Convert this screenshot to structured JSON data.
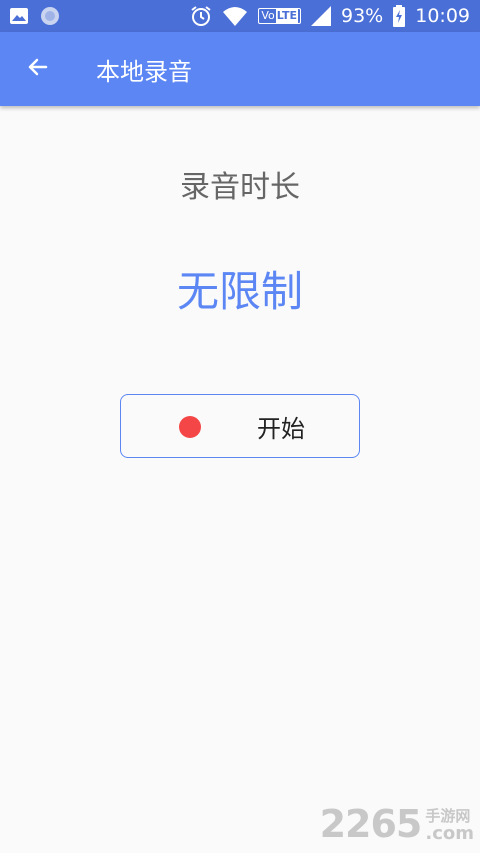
{
  "status_bar": {
    "battery_percent": "93%",
    "time": "10:09",
    "volte_label": "Vo",
    "lte_label": "LTE",
    "icons": [
      "image-icon",
      "sync-icon",
      "alarm-icon",
      "wifi-icon",
      "volte-icon",
      "signal-icon",
      "battery-icon"
    ]
  },
  "app_bar": {
    "title": "本地录音",
    "back_icon": "arrow-left-icon",
    "color": "#5b86f4"
  },
  "main": {
    "duration_label": "录音时长",
    "duration_value": "无限制",
    "start_button": {
      "label": "开始",
      "dot_color": "#f44646"
    }
  },
  "watermark": {
    "number": "2265",
    "cn_text": "手游网",
    "com_text": ".com"
  },
  "colors": {
    "status_bar": "#4a6fd6",
    "accent": "#5b86f4",
    "background": "#fafafa"
  }
}
